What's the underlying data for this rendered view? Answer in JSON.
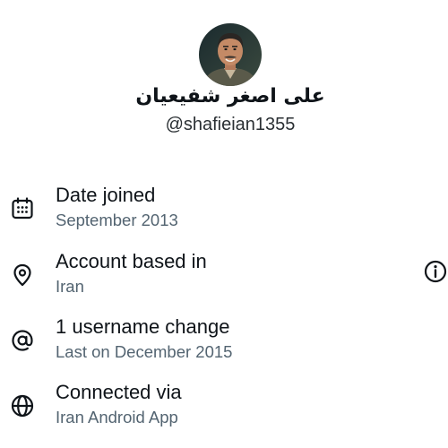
{
  "profile": {
    "display_name": "علی اصغر شفیعیان",
    "handle": "@shafieian1355"
  },
  "about": {
    "items": [
      {
        "title": "Date joined",
        "subtitle": "September 2013",
        "icon": "calendar-icon"
      },
      {
        "title": "Account based in",
        "subtitle": "Iran",
        "icon": "location-pin-icon"
      },
      {
        "title": "1 username change",
        "subtitle": "Last on December 2015",
        "icon": "at-sign-icon"
      },
      {
        "title": "Connected via",
        "subtitle": "Iran Android App",
        "icon": "globe-icon"
      }
    ]
  },
  "icons": {
    "info": "info-icon"
  },
  "colors": {
    "primary_text": "#0f1419",
    "secondary_text": "#536471",
    "background": "#ffffff"
  }
}
